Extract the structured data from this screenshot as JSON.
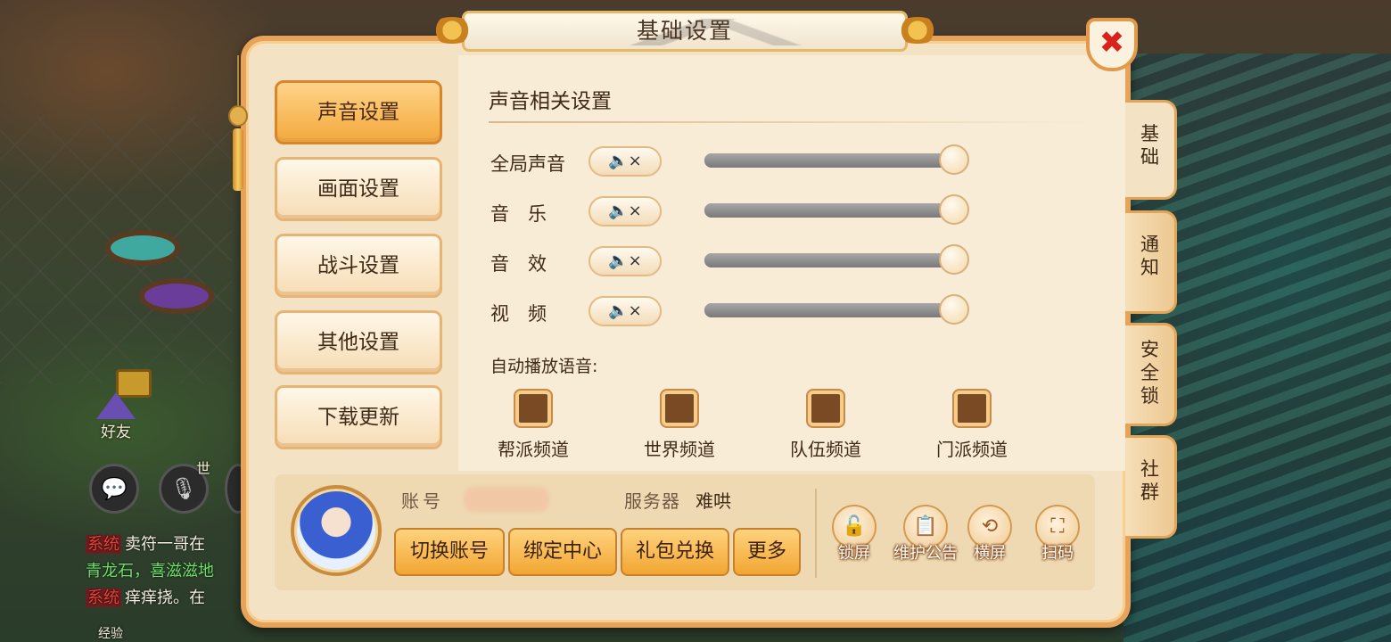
{
  "dialog": {
    "title": "基础设置",
    "close_symbol": "✖"
  },
  "left_menu": {
    "items": [
      {
        "label": "声音设置",
        "active": true
      },
      {
        "label": "画面设置",
        "active": false
      },
      {
        "label": "战斗设置",
        "active": false
      },
      {
        "label": "其他设置",
        "active": false
      },
      {
        "label": "下载更新",
        "active": false
      }
    ]
  },
  "sound": {
    "section_title": "声音相关设置",
    "rows": [
      {
        "label": "全局声音",
        "mute_symbol": "🔈×",
        "level_percent": 100
      },
      {
        "label": "音　乐",
        "mute_symbol": "🔈×",
        "level_percent": 100
      },
      {
        "label": "音　效",
        "mute_symbol": "🔈×",
        "level_percent": 100
      },
      {
        "label": "视　频",
        "mute_symbol": "🔈×",
        "level_percent": 100
      }
    ],
    "auto_voice_label": "自动播放语音:",
    "channels": [
      {
        "label": "帮派频道",
        "checked": false
      },
      {
        "label": "世界频道",
        "checked": false
      },
      {
        "label": "队伍频道",
        "checked": false
      },
      {
        "label": "门派频道",
        "checked": false
      }
    ]
  },
  "side_tabs": [
    {
      "label": "基\n础",
      "active": true
    },
    {
      "label": "通\n知",
      "active": false
    },
    {
      "label": "安\n全\n锁",
      "active": false
    },
    {
      "label": "社\n群",
      "active": false
    }
  ],
  "account": {
    "account_label": "账号",
    "server_label": "服务器",
    "server_value": "难哄",
    "buttons": [
      "切换账号",
      "绑定中心",
      "礼包兑换",
      "更多"
    ],
    "tools": [
      {
        "label": "锁屏",
        "icon": "lock-icon",
        "glyph": "🔓"
      },
      {
        "label": "维护公告",
        "icon": "notice-icon",
        "glyph": "📋"
      },
      {
        "label": "横屏",
        "icon": "rotate-screen-icon",
        "glyph": "⟲"
      },
      {
        "label": "扫码",
        "icon": "scan-icon",
        "glyph": "⛶"
      }
    ]
  },
  "background": {
    "friend_label": "好友",
    "world_label": "世",
    "chat": [
      {
        "tag": "系统",
        "text": "卖符一哥在"
      },
      {
        "tag": "",
        "text": "青龙石，喜滋滋地"
      },
      {
        "tag": "系统",
        "text": "痒痒挠。在"
      }
    ],
    "exp_label": "经验"
  },
  "colors": {
    "accent": "#f3a93b",
    "panel": "#f4e2c4",
    "close": "#d9221c"
  }
}
